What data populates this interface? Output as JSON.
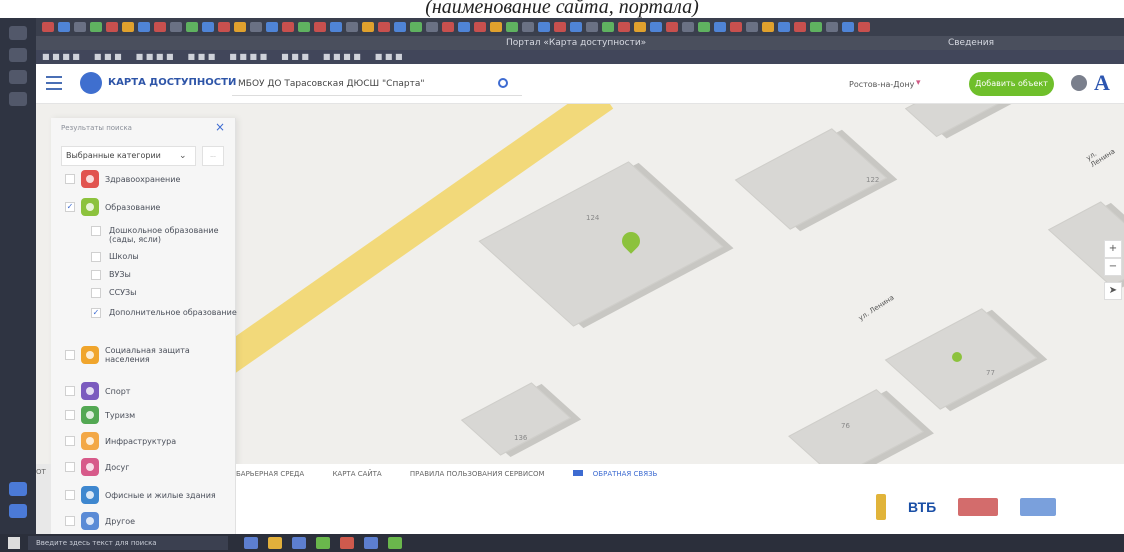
{
  "caption": "(наименование сайта, портала)",
  "browser": {
    "page_title": "Портал «Карта доступности»",
    "zoom": "Сведения"
  },
  "header": {
    "logo": "КАРТА ДОСТУПНОСТИ",
    "search_value": "МБОУ ДО Тарасовская ДЮСШ \"Спарта\"",
    "city": "Ростов-на-Дону",
    "add_button": "Добавить объект",
    "font_toggle": "A"
  },
  "panel": {
    "heading": "Результаты поиска",
    "close": "×",
    "select_value": "Выбранные категории",
    "select_btn": "...",
    "categories": [
      {
        "label": "Здравоохранение",
        "color": "#e1544f",
        "checked": false
      },
      {
        "label": "Образование",
        "color": "#8cc23d",
        "checked": true
      },
      {
        "label": "Социальная защита населения",
        "color": "#f0a52c",
        "checked": false
      },
      {
        "label": "Спорт",
        "color": "#7b5bbf",
        "checked": false
      },
      {
        "label": "Туризм",
        "color": "#53a853",
        "checked": false
      },
      {
        "label": "Инфраструктура",
        "color": "#f3a846",
        "checked": false
      },
      {
        "label": "Досуг",
        "color": "#d75a8a",
        "checked": false
      },
      {
        "label": "Офисные и жилые здания",
        "color": "#3e87cf",
        "checked": false
      },
      {
        "label": "Другое",
        "color": "#5a8bd6",
        "checked": false
      }
    ],
    "subcategories": [
      {
        "label": "Дошкольное образование (сады, ясли)",
        "checked": false
      },
      {
        "label": "Школы",
        "checked": false
      },
      {
        "label": "ВУЗы",
        "checked": false
      },
      {
        "label": "ССУЗы",
        "checked": false
      },
      {
        "label": "Дополнительное образование",
        "checked": true
      }
    ]
  },
  "map": {
    "streets": [
      "ул. Ленина",
      "ул. Ленина"
    ],
    "building_numbers": [
      "124",
      "122",
      "76",
      "136",
      "77"
    ]
  },
  "footer": {
    "links": [
      "БАРЬЕРНАЯ СРЕДА",
      "КАРТА САЙТА",
      "ПРАВИЛА ПОЛЬЗОВАНИЯ СЕРВИСОМ"
    ],
    "feedback": "ОБРАТНАЯ СВЯЗЬ",
    "vtb": "ВТБ",
    "left_label": "ОТ"
  },
  "taskbar": {
    "search_placeholder": "Введите здесь текст для поиска"
  }
}
